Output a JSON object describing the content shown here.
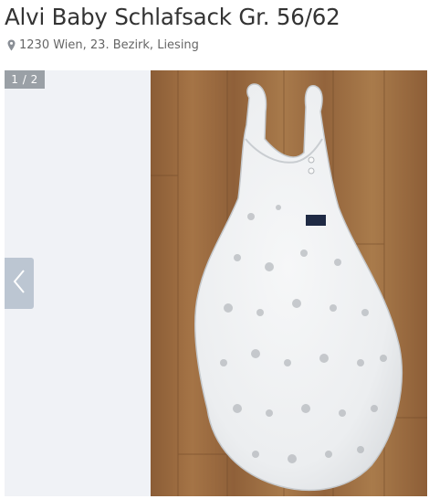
{
  "listing": {
    "title": "Alvi Baby Schlafsack Gr. 56/62",
    "location": "1230 Wien, 23. Bezirk, Liesing"
  },
  "gallery": {
    "counter": "1 / 2",
    "current": 1,
    "total": 2
  },
  "icons": {
    "location": "map-pin-icon",
    "prev": "chevron-left-icon"
  }
}
